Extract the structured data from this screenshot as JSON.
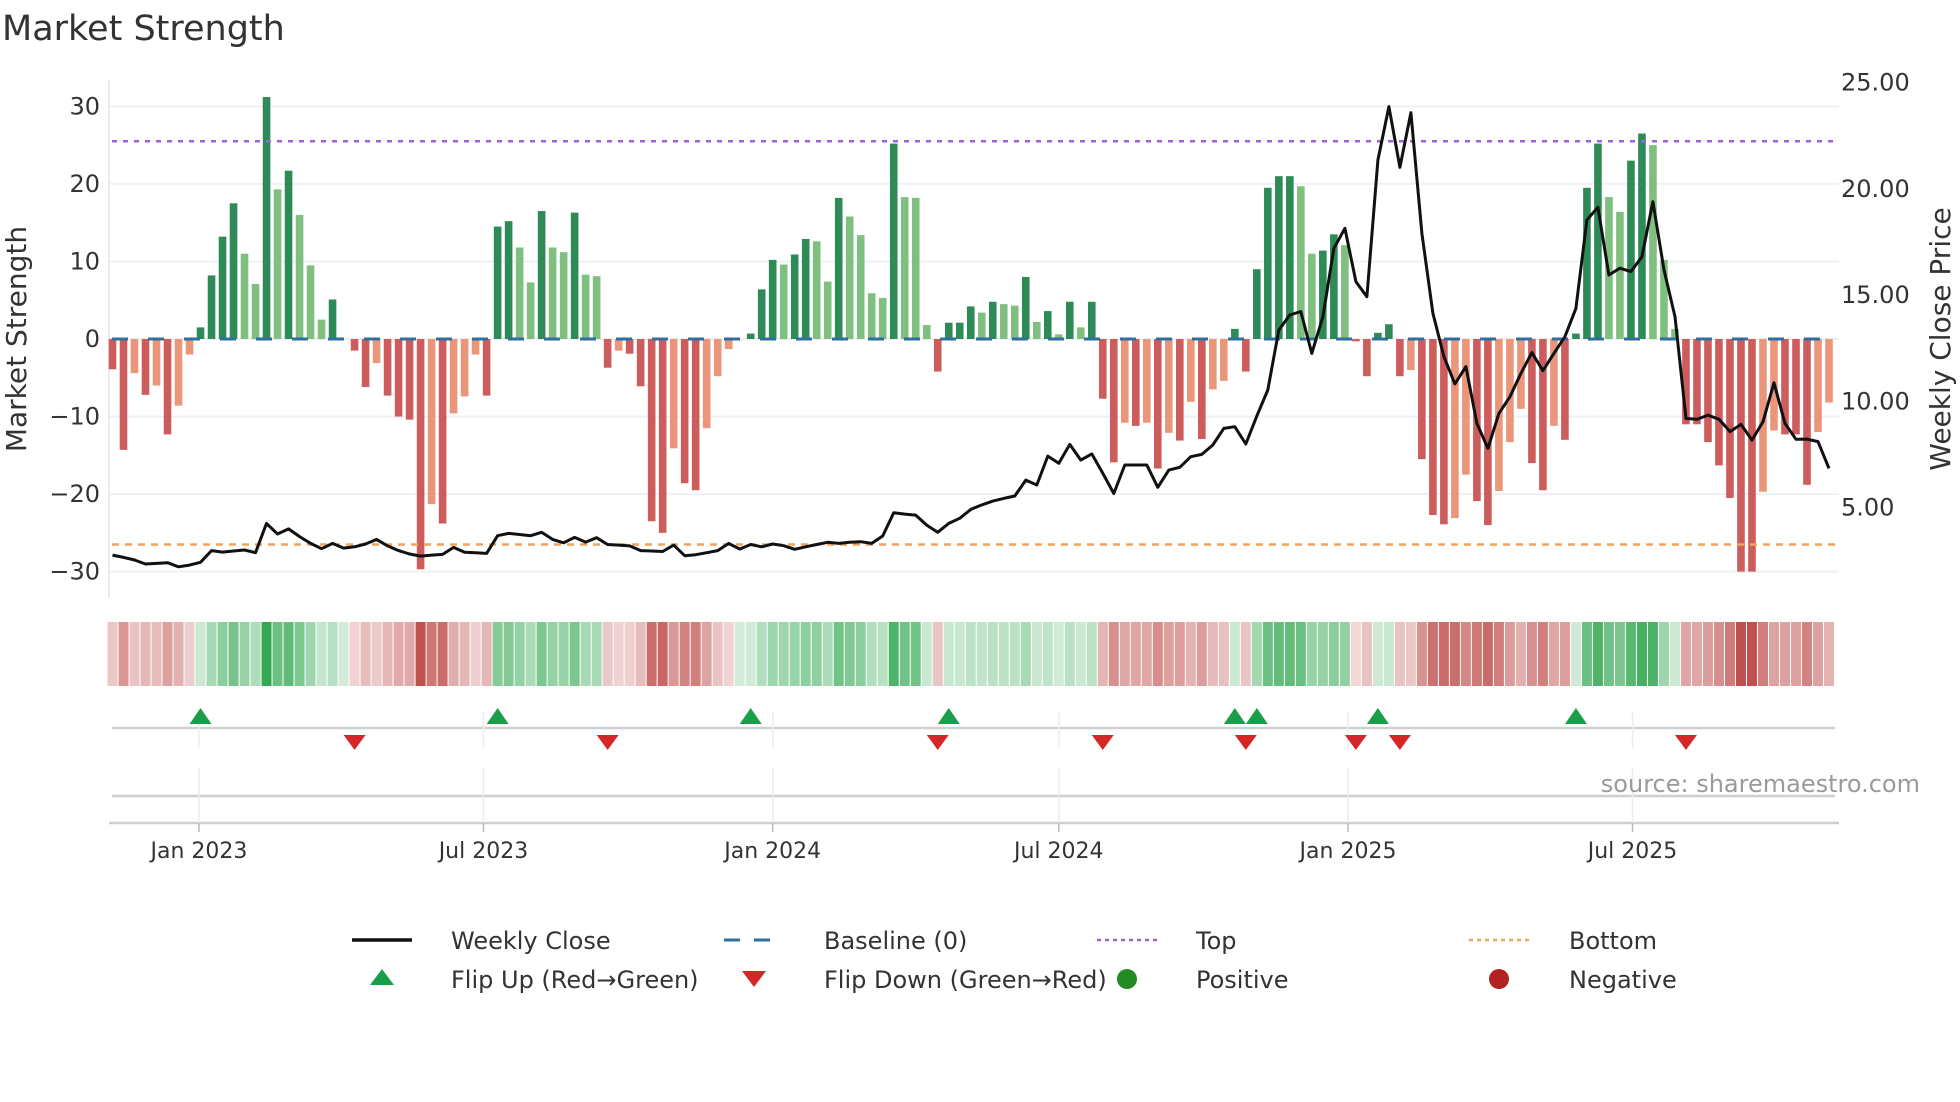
{
  "title": "Market Strength",
  "source": "source: sharemaestro.com",
  "chart_data": {
    "type": "bar",
    "title": "Market Strength",
    "ylabel": "Market Strength",
    "y2label": "Weekly Close Price",
    "ylim": [
      -33.4,
      33.4
    ],
    "y2lim": [
      0.74,
      25.12
    ],
    "y_ticks": [
      -30,
      -20,
      -10,
      0,
      10,
      20,
      30
    ],
    "y_tick_labels": [
      "−30",
      "−20",
      "−10",
      "0",
      "10",
      "20",
      "30"
    ],
    "y2_ticks": [
      5,
      10,
      15,
      20,
      25
    ],
    "y2_tick_labels": [
      "5.00",
      "10.00",
      "15.00",
      "20.00",
      "25.00"
    ],
    "grid": true,
    "week_start": "2022-11-07",
    "x_ticks": [
      {
        "label": "Jan 2023",
        "date": "2023-01-01"
      },
      {
        "label": "Jul 2023",
        "date": "2023-07-01"
      },
      {
        "label": "Jan 2024",
        "date": "2024-01-01"
      },
      {
        "label": "Jul 2024",
        "date": "2024-07-01"
      },
      {
        "label": "Jan 2025",
        "date": "2025-01-01"
      },
      {
        "label": "Jul 2025",
        "date": "2025-07-01"
      }
    ],
    "strength": [
      -3.9,
      -14.3,
      -4.4,
      -7.2,
      -6,
      -12.3,
      -8.6,
      -2,
      1.5,
      8.2,
      13.2,
      17.5,
      11,
      7.1,
      31.2,
      19.3,
      21.7,
      16,
      9.5,
      2.5,
      5.1,
      0,
      -1.5,
      -6.2,
      -3.1,
      -7.3,
      -10,
      -10.4,
      -29.7,
      -21.3,
      -23.8,
      -9.6,
      -7.4,
      -2,
      -7.3,
      14.5,
      15.2,
      11.8,
      7.3,
      16.5,
      11.8,
      11.2,
      16.3,
      8.3,
      8.1,
      -3.7,
      -1.5,
      -1.9,
      -6.1,
      -23.5,
      -25,
      -14.1,
      -18.6,
      -19.5,
      -11.5,
      -4.8,
      -1.3,
      0,
      0.7,
      6.4,
      10.2,
      9.6,
      10.9,
      12.9,
      12.6,
      7.4,
      18.2,
      15.8,
      13.4,
      5.9,
      5.3,
      25.2,
      18.3,
      18.2,
      1.8,
      -4.2,
      2.1,
      2.1,
      4.2,
      3.4,
      4.8,
      4.5,
      4.3,
      8,
      2.2,
      3.6,
      0.6,
      4.8,
      1.5,
      4.8,
      -7.7,
      -15.9,
      -10.8,
      -11.2,
      -10.8,
      -16.7,
      -12.1,
      -13.1,
      -8.1,
      -12.9,
      -6.5,
      -5.4,
      1.3,
      -4.2,
      9,
      19.5,
      21,
      21,
      19.7,
      11,
      11.4,
      13.5,
      12.1,
      -0.3,
      -4.8,
      0.8,
      1.9,
      -4.8,
      -4,
      -15.5,
      -22.7,
      -23.9,
      -23.1,
      -17.5,
      -20.9,
      -24,
      -19.6,
      -13.3,
      -9,
      -16,
      -19.5,
      -11.2,
      -13,
      0.7,
      19.5,
      25.2,
      18.3,
      16.4,
      23,
      26.5,
      25,
      10.2,
      1.3,
      -11,
      -11,
      -13.3,
      -16.3,
      -20.5,
      -30,
      -30,
      -19.7,
      -11.8,
      -12.3,
      -12.3,
      -18.8,
      -12,
      -8.2
    ],
    "weekly_close": [
      2.76,
      2.65,
      2.53,
      2.34,
      2.37,
      2.4,
      2.21,
      2.29,
      2.42,
      2.97,
      2.9,
      2.95,
      3,
      2.87,
      4.25,
      3.75,
      3.99,
      3.63,
      3.31,
      3.06,
      3.31,
      3.09,
      3.15,
      3.28,
      3.5,
      3.19,
      2.97,
      2.81,
      2.71,
      2.76,
      2.79,
      3.12,
      2.89,
      2.87,
      2.84,
      3.67,
      3.78,
      3.73,
      3.67,
      3.83,
      3.5,
      3.34,
      3.59,
      3.37,
      3.58,
      3.26,
      3.23,
      3.19,
      2.97,
      2.95,
      2.93,
      3.23,
      2.73,
      2.78,
      2.87,
      2.97,
      3.31,
      3.04,
      3.26,
      3.15,
      3.28,
      3.2,
      3.03,
      3.15,
      3.26,
      3.36,
      3.31,
      3.36,
      3.39,
      3.31,
      3.66,
      4.75,
      4.69,
      4.64,
      4.17,
      3.83,
      4.25,
      4.49,
      4.91,
      5.12,
      5.3,
      5.43,
      5.54,
      6.29,
      6.06,
      7.42,
      7.08,
      7.97,
      7.23,
      7.52,
      6.61,
      5.66,
      7,
      7,
      7,
      5.95,
      6.76,
      6.89,
      7.39,
      7.5,
      7.94,
      8.72,
      8.8,
      7.99,
      9.3,
      10.53,
      13.35,
      14.06,
      14.22,
      12.25,
      13.98,
      17.2,
      18.14,
      15.63,
      14.92,
      21.35,
      23.87,
      21.01,
      23.58,
      17.9,
      14.14,
      12.1,
      10.81,
      11.63,
      8.96,
      7.78,
      9.43,
      10.21,
      11.31,
      12.29,
      11.44,
      12.25,
      13.04,
      14.37,
      18.53,
      19.13,
      15.94,
      16.26,
      16.1,
      16.8,
      19.39,
      16.18,
      13.98,
      9.19,
      9.15,
      9.35,
      9.15,
      8.57,
      8.91,
      8.17,
      9.04,
      10.87,
      8.96,
      8.21,
      8.22,
      8.1,
      6.84
    ],
    "top": 25.5,
    "bottom": -26.5,
    "baseline": 0,
    "flip_up_weeks": [
      9,
      36,
      59,
      77,
      103,
      105,
      116,
      134
    ],
    "flip_down_weeks": [
      23,
      46,
      76,
      91,
      104,
      114,
      118,
      144
    ],
    "legend_placement": "bottom",
    "legend": [
      {
        "key": "close",
        "label": "Weekly Close"
      },
      {
        "key": "baseline",
        "label": "Baseline (0)"
      },
      {
        "key": "top",
        "label": "Top"
      },
      {
        "key": "bottom",
        "label": "Bottom"
      },
      {
        "key": "flip_up",
        "label": "Flip Up (Red→Green)"
      },
      {
        "key": "flip_down",
        "label": "Flip Down (Green→Red)"
      },
      {
        "key": "positive",
        "label": "Positive"
      },
      {
        "key": "negative",
        "label": "Negative"
      }
    ],
    "colors": {
      "pos_strong": "#2e8b57",
      "pos_weak": "#7fbf7f",
      "neg_strong": "#cd5c5c",
      "neg_weak": "#e9967a",
      "close": "#111111",
      "baseline": "#2f6f9f",
      "top": "#9a64d6",
      "bottom": "#f2a35e",
      "flip_up": "#1a9e4a",
      "flip_down": "#d62728",
      "positive": "#228b22",
      "negative": "#b22222",
      "heat_pos": "#34a853",
      "heat_neg": "#c0504d"
    }
  }
}
